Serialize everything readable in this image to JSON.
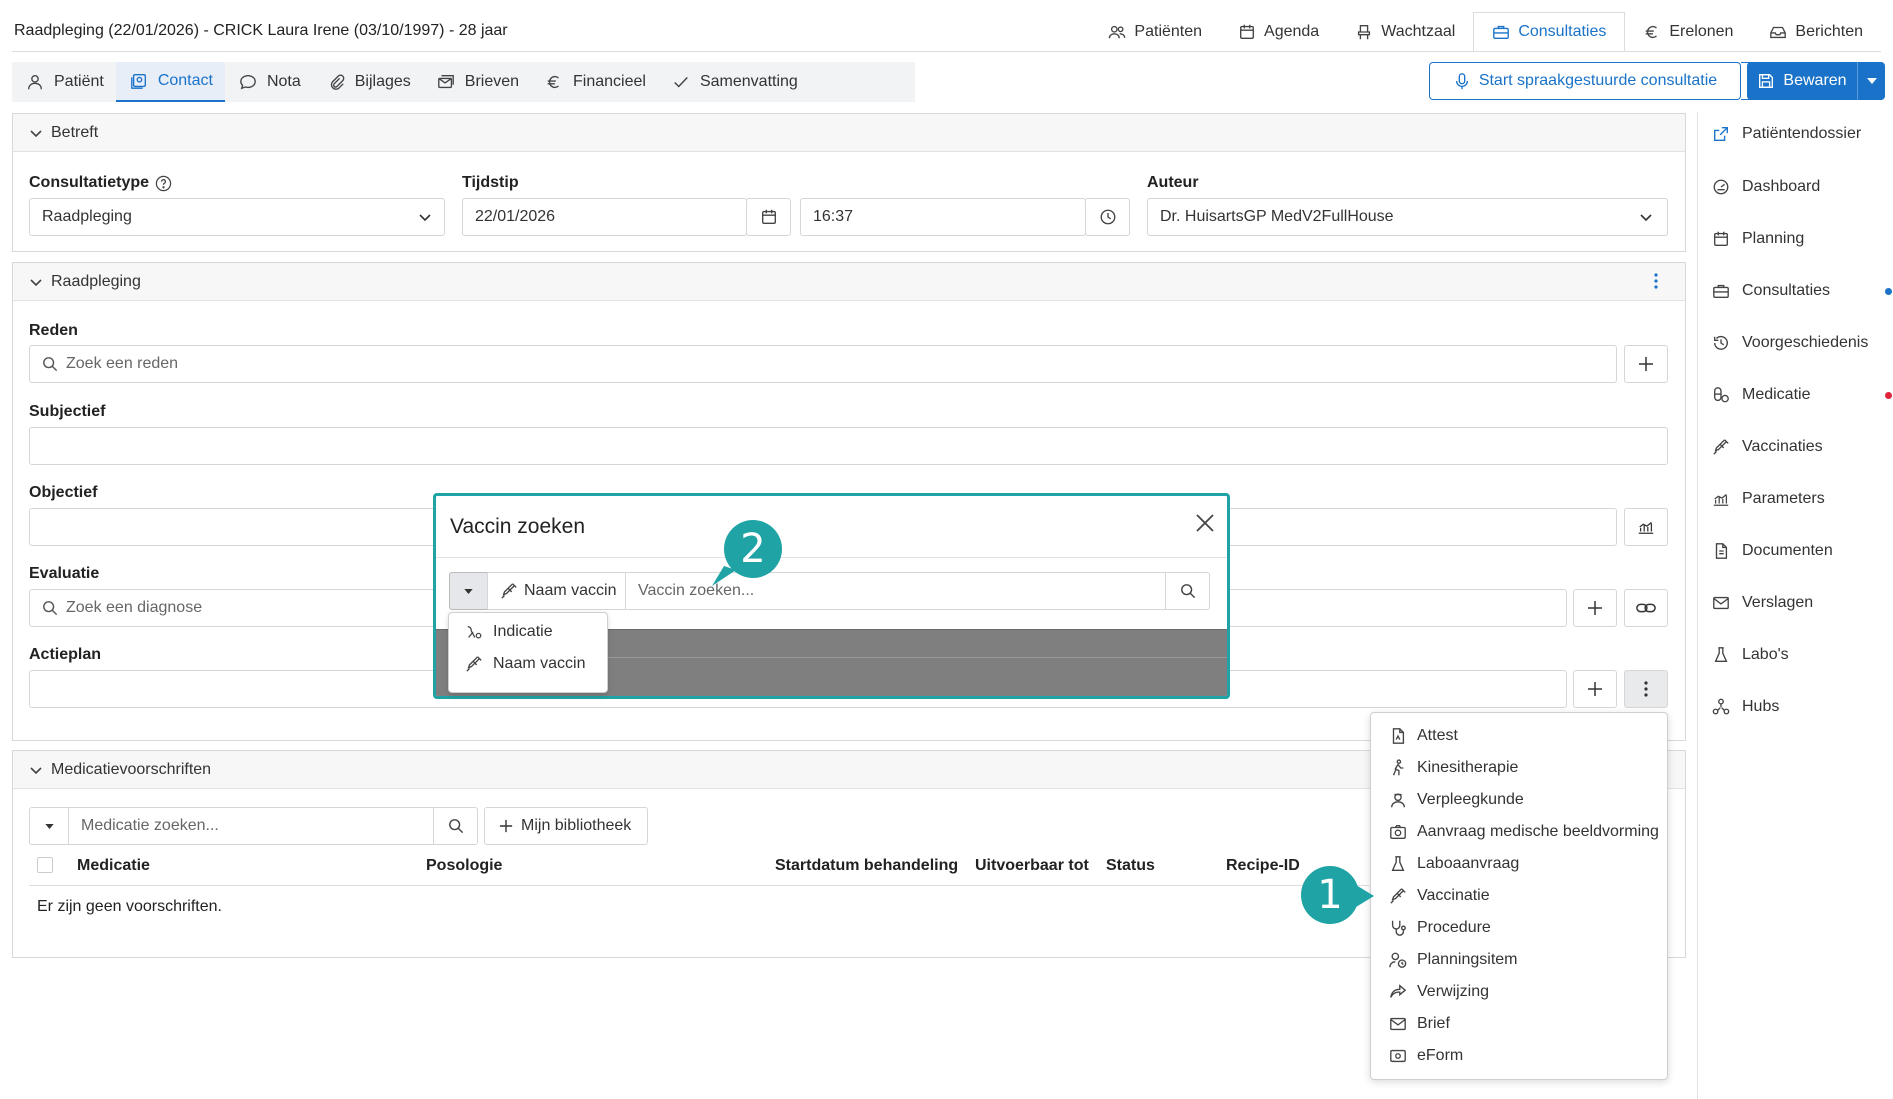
{
  "header": {
    "title": "Raadpleging (22/01/2026) - CRICK Laura Irene (03/10/1997) - 28 jaar",
    "nav": [
      {
        "label": "Patiënten",
        "icon": "users-icon"
      },
      {
        "label": "Agenda",
        "icon": "calendar-icon"
      },
      {
        "label": "Wachtzaal",
        "icon": "chair-icon"
      },
      {
        "label": "Consultaties",
        "icon": "briefcase-icon",
        "active": true
      },
      {
        "label": "Erelonen",
        "icon": "euro-icon"
      },
      {
        "label": "Berichten",
        "icon": "inbox-icon"
      }
    ]
  },
  "tabs": [
    {
      "label": "Patiënt",
      "icon": "person-icon"
    },
    {
      "label": "Contact",
      "icon": "contact-icon",
      "active": true
    },
    {
      "label": "Nota",
      "icon": "chat-icon"
    },
    {
      "label": "Bijlages",
      "icon": "paperclip-icon"
    },
    {
      "label": "Brieven",
      "icon": "letters-icon"
    },
    {
      "label": "Financieel",
      "icon": "euro-icon"
    },
    {
      "label": "Samenvatting",
      "icon": "check-icon"
    }
  ],
  "actions": {
    "voice_label": "Start spraakgestuurde consultatie",
    "save_label": "Bewaren"
  },
  "betreft": {
    "title": "Betreft",
    "consult_type_label": "Consultatietype",
    "consult_type_value": "Raadpleging",
    "time_label": "Tijdstip",
    "date_value": "22/01/2026",
    "time_value": "16:37",
    "author_label": "Auteur",
    "author_value": "Dr. HuisartsGP MedV2FullHouse"
  },
  "raadpleging": {
    "title": "Raadpleging",
    "reden_label": "Reden",
    "reden_placeholder": "Zoek een reden",
    "subjectief_label": "Subjectief",
    "objectief_label": "Objectief",
    "evaluatie_label": "Evaluatie",
    "evaluatie_placeholder": "Zoek een diagnose",
    "actieplan_label": "Actieplan"
  },
  "medicatie": {
    "title": "Medicatievoorschriften",
    "search_placeholder": "Medicatie zoeken...",
    "library_label": "Mijn bibliotheek",
    "columns": [
      "Medicatie",
      "Posologie",
      "Startdatum behandeling",
      "Uitvoerbaar tot",
      "Status",
      "Recipe-ID"
    ],
    "empty_text": "Er zijn geen voorschriften."
  },
  "sidebar": [
    {
      "label": "Patiëntendossier",
      "icon": "external-link-icon"
    },
    {
      "label": "Dashboard",
      "icon": "dashboard-icon"
    },
    {
      "label": "Planning",
      "icon": "calendar-icon"
    },
    {
      "label": "Consultaties",
      "icon": "briefcase-icon",
      "dot": "#1a73c9"
    },
    {
      "label": "Voorgeschiedenis",
      "icon": "history-icon"
    },
    {
      "label": "Medicatie",
      "icon": "pills-icon",
      "dot": "#e0243a"
    },
    {
      "label": "Vaccinaties",
      "icon": "syringe-icon"
    },
    {
      "label": "Parameters",
      "icon": "chart-icon"
    },
    {
      "label": "Documenten",
      "icon": "document-icon"
    },
    {
      "label": "Verslagen",
      "icon": "envelope-icon"
    },
    {
      "label": "Labo's",
      "icon": "flask-icon"
    },
    {
      "label": "Hubs",
      "icon": "hubs-icon"
    }
  ],
  "action_menu": [
    {
      "label": "Attest",
      "icon": "file-icon"
    },
    {
      "label": "Kinesitherapie",
      "icon": "walking-icon"
    },
    {
      "label": "Verpleegkunde",
      "icon": "nurse-icon"
    },
    {
      "label": "Aanvraag medische beeldvorming",
      "icon": "camera-icon"
    },
    {
      "label": "Laboaanvraag",
      "icon": "flask-icon"
    },
    {
      "label": "Vaccinatie",
      "icon": "syringe-icon"
    },
    {
      "label": "Procedure",
      "icon": "stethoscope-icon"
    },
    {
      "label": "Planningsitem",
      "icon": "person-clock-icon"
    },
    {
      "label": "Verwijzing",
      "icon": "share-icon"
    },
    {
      "label": "Brief",
      "icon": "envelope-icon"
    },
    {
      "label": "eForm",
      "icon": "eform-icon"
    }
  ],
  "modal": {
    "title": "Vaccin zoeken",
    "search_type_label": "Naam vaccin",
    "search_placeholder": "Vaccin zoeken...",
    "type_options": [
      "Indicatie",
      "Naam vaccin"
    ]
  },
  "markers": [
    "1",
    "2"
  ],
  "colors": {
    "accent": "#1a73c9",
    "teal": "#1fa3a5",
    "alert": "#e0243a"
  }
}
